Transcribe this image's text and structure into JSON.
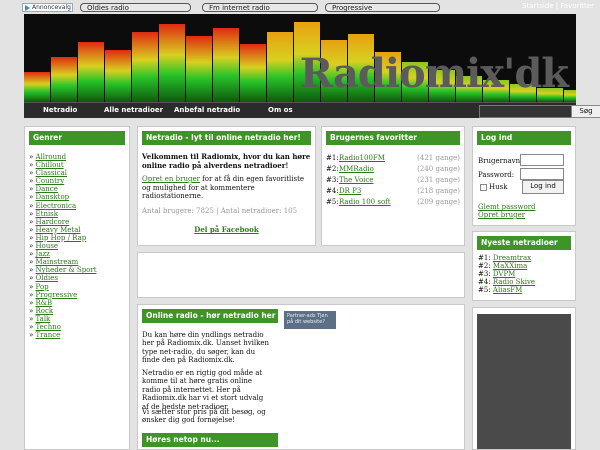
{
  "topbar": {
    "ad_label": "Annoncevalg",
    "pills": [
      "Oldies radio",
      "Fm internet radio",
      "Progressive"
    ],
    "links": [
      "Startside",
      "Favoritter"
    ],
    "link_sep": "|"
  },
  "header": {
    "logo": "Radiomix'dk"
  },
  "nav": {
    "items": [
      "Netradio",
      "Alle netradioer",
      "Anbefal netradio",
      "Om os"
    ],
    "search_button": "Søg",
    "search_value": ""
  },
  "genres": {
    "title": "Genrer",
    "items": [
      "Allround",
      "Chillout",
      "Classical",
      "Country",
      "Dance",
      "Dansktop",
      "Electronica",
      "Etnisk",
      "Hardcore",
      "Heavy Metal",
      "Hip Hop / Rap",
      "House",
      "Jazz",
      "Mainstream",
      "Nyheder & Sport",
      "Oldies",
      "Pop",
      "Progressive",
      "R&B",
      "Rock",
      "Talk",
      "Techno",
      "Trance"
    ]
  },
  "intro": {
    "title": "Netradio - lyt til online netradio her!",
    "lead": "Velkommen til Radiomix, hvor du kan høre online radio på alverdens netradioer!",
    "link": "Opret en bruger",
    "text": " for at få din egen favoritliste og mulighed for at kommentere radiostationerne.",
    "stats_users": "Antal brugere: 7825",
    "stats_sep": "|",
    "stats_radios": "Antal netradioer: 105",
    "share": "Del på Facebook"
  },
  "favorites": {
    "title": "Brugernes favoritter",
    "items": [
      {
        "n": "#1:",
        "name": "Radio100FM",
        "count": "(421 gange)"
      },
      {
        "n": "#2:",
        "name": "MMRadio",
        "count": "(240 gange)"
      },
      {
        "n": "#3:",
        "name": "The Voice",
        "count": "(231 gange)"
      },
      {
        "n": "#4:",
        "name": "DR P3",
        "count": "(218 gange)"
      },
      {
        "n": "#5:",
        "name": "Radio 100 soft",
        "count": "(209 gange)"
      }
    ]
  },
  "login": {
    "title": "Log ind",
    "user_label": "Brugernavn:",
    "pass_label": "Password:",
    "remember": "Husk",
    "button": "Log ind",
    "forgot": "Glemt password",
    "register": "Opret bruger"
  },
  "newest": {
    "title": "Nyeste netradioer",
    "items": [
      {
        "n": "#1:",
        "name": "Dreamtrax"
      },
      {
        "n": "#2:",
        "name": "MaXXima"
      },
      {
        "n": "#3:",
        "name": "DVPM"
      },
      {
        "n": "#4:",
        "name": "Radio Skive"
      },
      {
        "n": "#5:",
        "name": "AliasFM"
      }
    ]
  },
  "online": {
    "title": "Online radio - hør netradio her",
    "p1": "Du kan høre din yndlings netradio her på Radiomix.dk. Uanset hvilken type net-radio, du søger, kan du finde den på Radiomix.dk.",
    "p2": "Netradio er en rigtig god måde at komme til at høre gratis online radio på internettet. Her på Radiomix.dk har vi et stort udvalg af de bedste net-radioer.",
    "p3": "Vi sætter stor pris på dit besøg, og ønsker dig god fornøjelse!",
    "badge": "Partner-ads Tjen på dit website?"
  },
  "listening": {
    "title": "Høres netop nu..."
  },
  "colors": {
    "accent": "#3e9427",
    "link": "#2a7a18",
    "nav_bg": "#2b2b2b"
  }
}
